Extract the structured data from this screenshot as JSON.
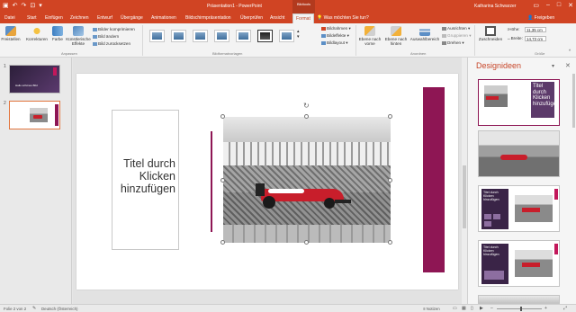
{
  "titlebar": {
    "title": "Präsentation1 - PowerPoint",
    "context_tab": "Bildtools",
    "user": "Katharina Schwarzer"
  },
  "tabs": [
    "Datei",
    "Start",
    "Einfügen",
    "Zeichnen",
    "Entwurf",
    "Übergänge",
    "Animationen",
    "Bildschirmpräsentation",
    "Überprüfen",
    "Ansicht",
    "Format"
  ],
  "active_tab": "Format",
  "tell_me": "Was möchten Sie tun?",
  "share": "Freigeben",
  "ribbon": {
    "freistellen": "Freistellen",
    "korrekturen": "Korrekturen",
    "farbe": "Farbe",
    "kuenstlerische": "Künstlerische Effekte",
    "bilder_komprimieren": "Bilder komprimieren",
    "bild_aendern": "Bild ändern",
    "bild_zuruecksetzen": "Bild zurücksetzen",
    "group_anpassen": "Anpassen",
    "group_bildformatvorlagen": "Bildformatvorlagen",
    "bildrahmen": "Bildrahmen",
    "bildeffekte": "Bildeffekte",
    "bildlayout": "Bildlayout",
    "ebene_nach_vorne": "Ebene nach vorne",
    "ebene_nach_hinten": "Ebene nach hinten",
    "auswahlbereich": "Auswahlbereich",
    "ausrichten": "Ausrichten",
    "gruppieren": "Gruppieren",
    "drehen": "Drehen",
    "group_anordnen": "Anordnen",
    "zuschneiden": "Zuschneiden",
    "hoehe_label": "Höhe:",
    "hoehe_value": "11,35 cm",
    "breite_label": "Breite:",
    "breite_value": "14,73 cm",
    "group_groesse": "Größe"
  },
  "slides": [
    {
      "number": "1",
      "thumb_text": "Hallo schönes Bild"
    },
    {
      "number": "2"
    }
  ],
  "slide": {
    "title_placeholder": "Titel durch Klicken hinzufügen"
  },
  "design_pane": {
    "header": "Designideen",
    "thumb1_text": "Titel durch Klicken hinzufügen",
    "thumb3_text": "Titel durch Klicken hinzufügen",
    "thumb4_text": "Titel durch Klicken hinzufügen"
  },
  "statusbar": {
    "slide_info": "Folie 2 von 2",
    "language": "Deutsch (Österreich)",
    "notes": "Notizen"
  },
  "colors": {
    "accent": "#d04423",
    "slide_bar": "#8e1654",
    "thumb_dark": "#3a2447"
  }
}
